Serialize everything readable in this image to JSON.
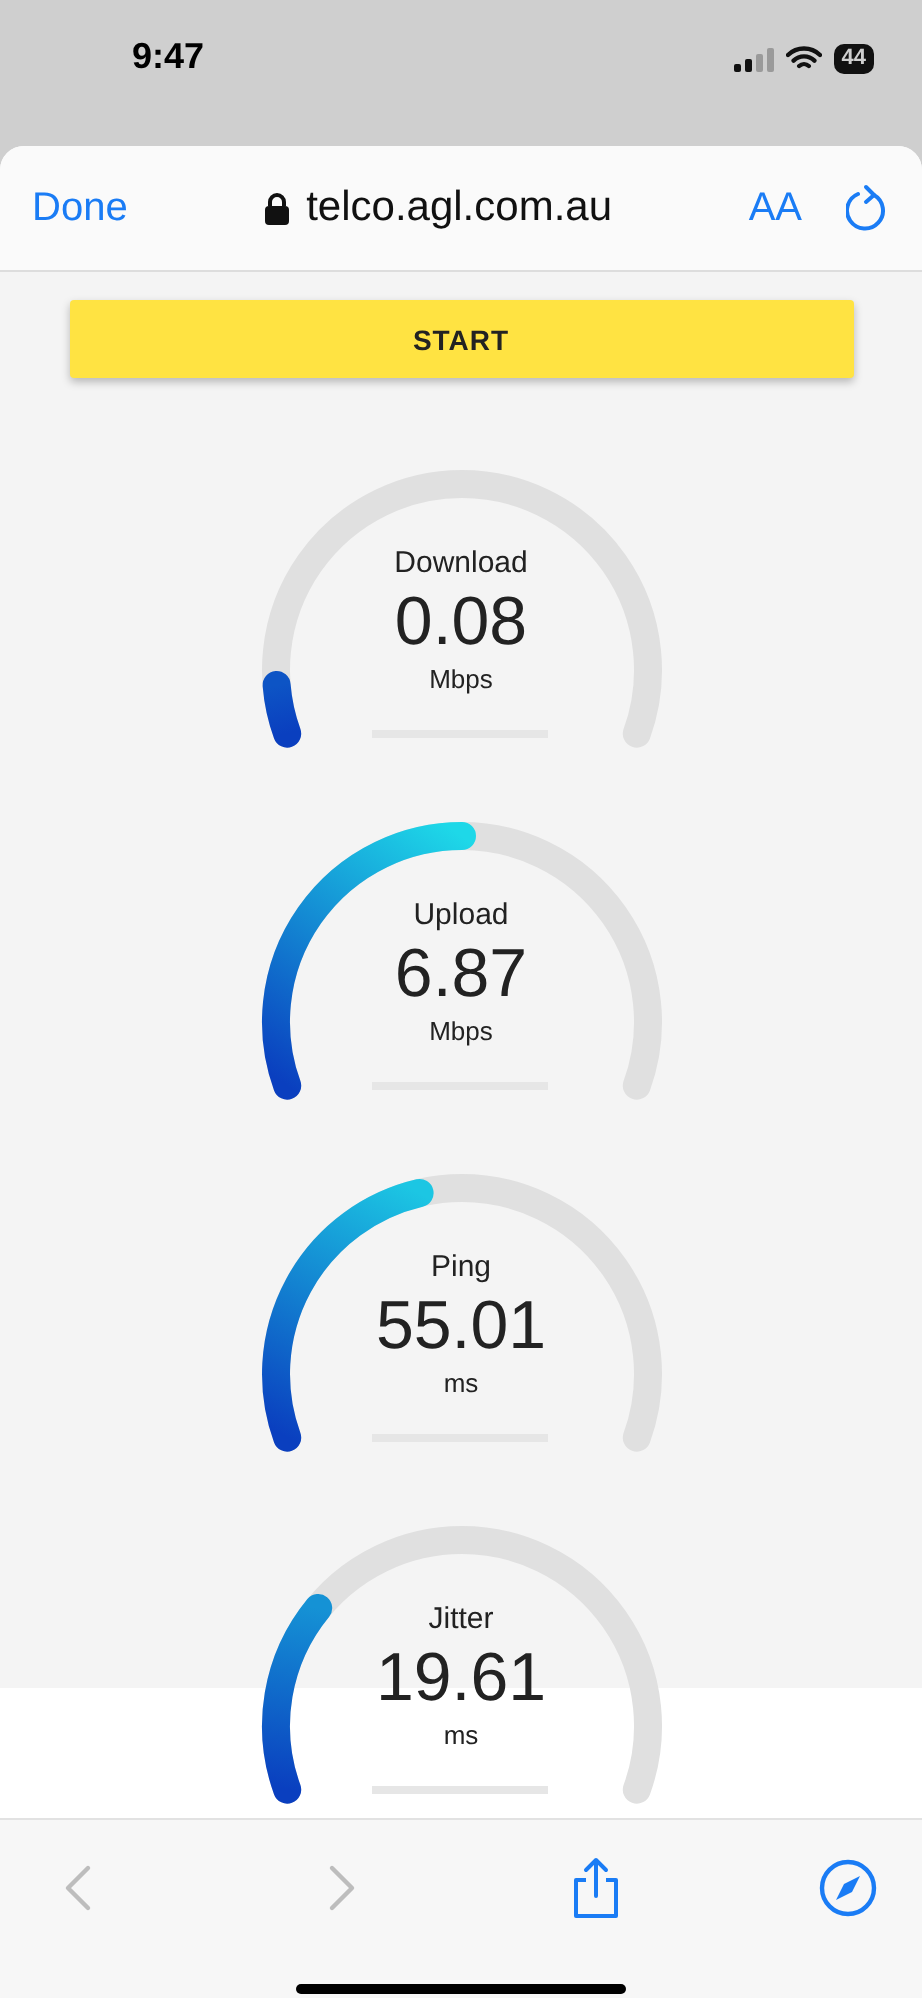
{
  "status_bar": {
    "time": "9:47",
    "battery": "44"
  },
  "browser": {
    "done": "Done",
    "url": "telco.agl.com.au",
    "text_size": "AA"
  },
  "start_button": "START",
  "gauges": [
    {
      "label": "Download",
      "value": "0.08",
      "unit": "Mbps"
    },
    {
      "label": "Upload",
      "value": "6.87",
      "unit": "Mbps"
    },
    {
      "label": "Ping",
      "value": "55.01",
      "unit": "ms"
    },
    {
      "label": "Jitter",
      "value": "19.61",
      "unit": "ms"
    }
  ],
  "toolbar": {
    "back_disabled": true,
    "forward_disabled": true
  }
}
